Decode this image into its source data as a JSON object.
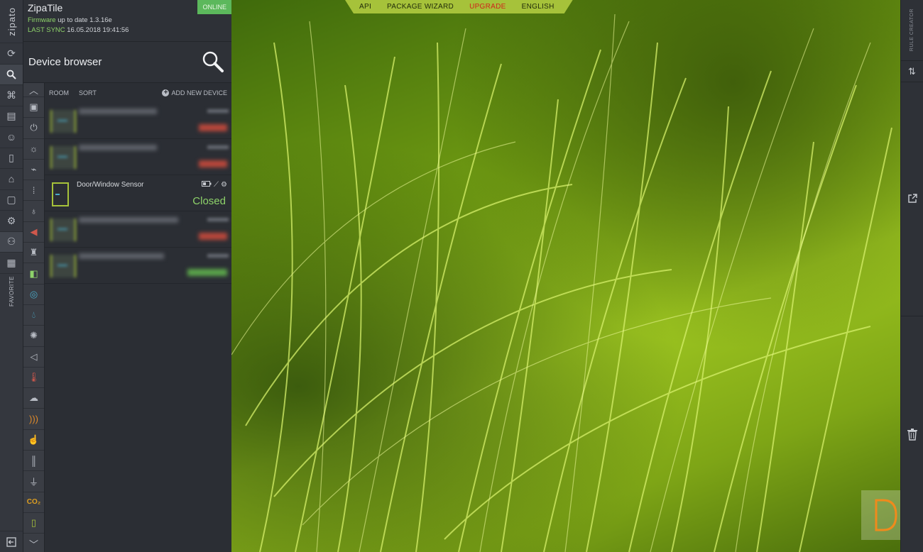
{
  "app": {
    "logo_text": "zipato",
    "device_name": "ZipaTile",
    "status_badge": "ONLINE",
    "firmware_label": "Firmware",
    "firmware_value": "up to date 1.3.16e",
    "last_sync_label": "LAST SYNC",
    "last_sync_value": "16.05.2018 19:41:56"
  },
  "left_rail": {
    "items": [
      "refresh-icon",
      "search-icon",
      "network-icon",
      "scenes-icon",
      "users-icon",
      "device-icon",
      "shield-icon",
      "box-icon",
      "gear-icon",
      "rules-icon",
      "calendar-icon"
    ],
    "favorite_label": "FAVORITE"
  },
  "device_browser": {
    "title": "Device browser",
    "room_label": "ROOM",
    "sort_label": "SORT",
    "add_label": "ADD NEW DEVICE",
    "devices": [
      {
        "name": "",
        "state": "",
        "status_color": "#b8473b"
      },
      {
        "name": "",
        "state": "",
        "status_color": "#b8473b"
      },
      {
        "name": "Door/Window Sensor",
        "state": "Closed",
        "status_color": "#8ed36a"
      },
      {
        "name": "",
        "state": "",
        "status_color": "#b8473b"
      },
      {
        "name": "",
        "state": "",
        "status_color": "#5aa34a"
      }
    ]
  },
  "category_icons": [
    "chevron-up-icon",
    "door-icon",
    "power-icon",
    "bulb-icon",
    "plug-icon",
    "dots-icon",
    "bulb-alt-icon",
    "siren-icon",
    "alarm-icon",
    "camera-icon",
    "gauge-icon",
    "water-drop-icon",
    "sun-icon",
    "speaker-icon",
    "thermometer-icon",
    "weather-icon",
    "signal-icon",
    "hand-icon",
    "bars-icon",
    "plug-alt-icon",
    "co2-icon",
    "door-sensor-icon",
    "chevron-down-icon"
  ],
  "top_menu": {
    "api": "API",
    "package_wizard": "PACKAGE WIZARD",
    "upgrade": "UPGRADE",
    "language": "ENGLISH"
  },
  "right_rail": {
    "rule_creator": "RULE CREATOR"
  },
  "colors": {
    "accent": "#a6c23a",
    "online": "#5cb85c",
    "upgrade": "#d0231b",
    "closed_state": "#8ed36a"
  }
}
